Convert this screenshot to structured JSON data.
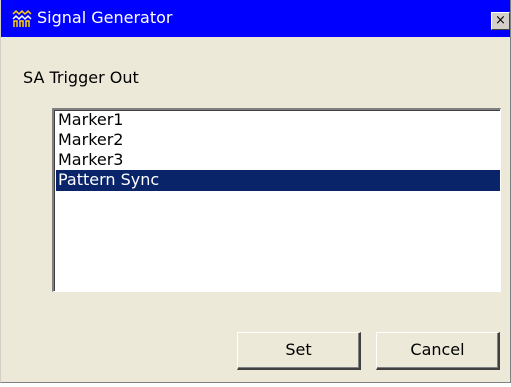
{
  "window": {
    "title": "Signal Generator",
    "close_glyph": "×",
    "icon": "signal-generator-icon"
  },
  "trigger": {
    "label": "SA Trigger Out",
    "items": [
      {
        "label": "Marker1",
        "selected": false
      },
      {
        "label": "Marker2",
        "selected": false
      },
      {
        "label": "Marker3",
        "selected": false
      },
      {
        "label": "Pattern Sync",
        "selected": true
      }
    ]
  },
  "buttons": {
    "set_label": "Set",
    "cancel_label": "Cancel"
  },
  "colors": {
    "titlebar": "#0000ff",
    "selection": "#0a246a",
    "dialog_bg": "#ece9d8"
  }
}
